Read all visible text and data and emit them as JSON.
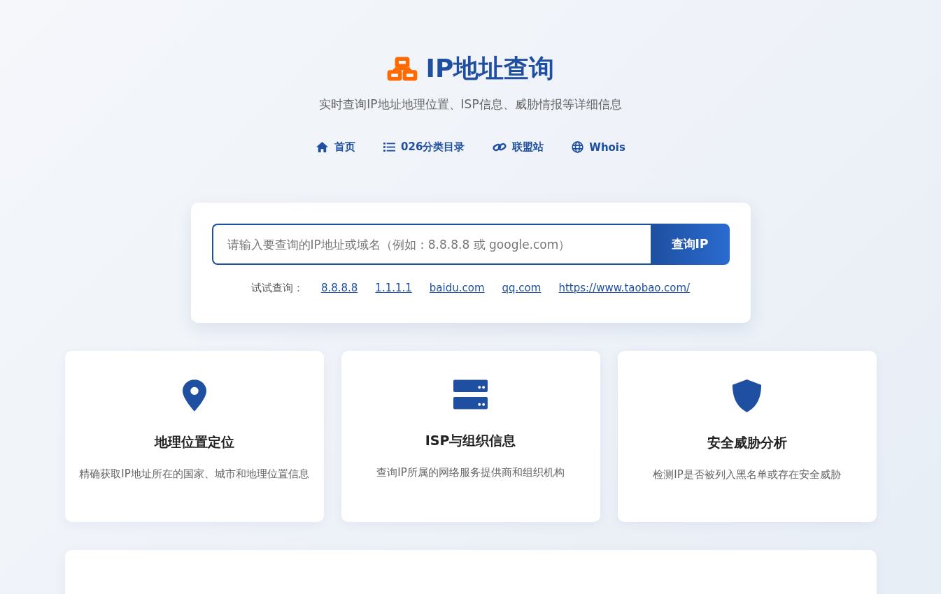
{
  "header": {
    "title": "IP地址查询",
    "subtitle": "实时查询IP地址地理位置、ISP信息、威胁情报等详细信息"
  },
  "nav": [
    {
      "kind": "home",
      "label": "首页"
    },
    {
      "kind": "list",
      "label": "026分类目录"
    },
    {
      "kind": "link",
      "label": "联盟站"
    },
    {
      "kind": "globe",
      "label": "Whois"
    }
  ],
  "search": {
    "placeholder": "请输入要查询的IP地址或域名（例如：8.8.8.8 或 google.com）",
    "button": "查询IP",
    "examples_label": "试试查询：",
    "examples": [
      "8.8.8.8",
      "1.1.1.1",
      "baidu.com",
      "qq.com",
      "https://www.taobao.com/"
    ]
  },
  "features": [
    {
      "kind": "pin",
      "title": "地理位置定位",
      "description": "精确获取IP地址所在的国家、城市和地理位置信息"
    },
    {
      "kind": "server",
      "title": "ISP与组织信息",
      "description": "查询IP所属的网络服务提供商和组织机构"
    },
    {
      "kind": "shield",
      "title": "安全威胁分析",
      "description": "检测IP是否被列入黑名单或存在安全威胁"
    }
  ]
}
